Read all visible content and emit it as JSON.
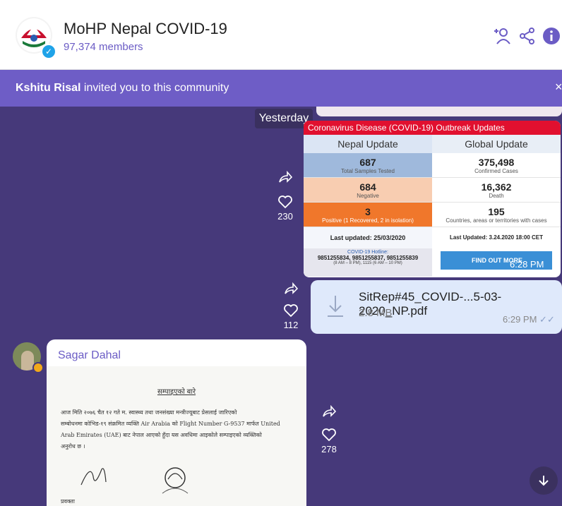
{
  "header": {
    "title": "MoHP Nepal COVID-19",
    "members": "97,374 members"
  },
  "banner": {
    "inviter": "Kshitu Risal",
    "text": " invited you to this community",
    "close": "×"
  },
  "chat": {
    "day_label": "Yesterday",
    "card": {
      "header": "Coronavirus Disease (COVID-19) Outbreak Updates",
      "nepal_title": "Nepal Update",
      "global_title": "Global Update",
      "nepal": [
        {
          "value": "687",
          "label": "Total Samples Tested"
        },
        {
          "value": "684",
          "label": "Negative"
        },
        {
          "value": "3",
          "label": "Positive (1 Recovered, 2 in isolation)"
        }
      ],
      "global": [
        {
          "value": "375,498",
          "label": "Confirmed Cases"
        },
        {
          "value": "16,362",
          "label": "Death"
        },
        {
          "value": "195",
          "label": "Countries, areas or territories with cases"
        }
      ],
      "nepal_updated": "Last updated: 25/03/2020",
      "global_updated": "Last Updated: 3.24.2020 18:00 CET",
      "hotline_title": "COVID-19 Hotline:",
      "hotline_numbers": "9851255834, 9851255837, 9851255839",
      "hotline_hours": "(8 AM – 8 PM), 1115 (6 AM – 10 PM)",
      "find_out_more": "FIND OUT MORE",
      "time": "6:28 PM",
      "likes": "230"
    },
    "pdf": {
      "filename": "SitRep#45_COVID-...5-03-2020_NP.pdf",
      "size": "2.8 MB",
      "time": "6:29 PM",
      "likes": "112"
    },
    "message": {
      "sender": "Sagar Dahal",
      "likes": "278",
      "doc_title": "सम्पाइएको बारे",
      "doc_line1": "आज मिति २०७६ चैत १२ गते म. स्वास्थ्य तथा जनसंख्या मन्त्रीज्यूबाट प्रेसलाई जारिएको",
      "doc_line2": "सम्बोधनमा कोभिड-१९ संक्रमित व्यक्ति Air Arabia को Flight Number G-9537 मार्फत United",
      "doc_line3": "Arab Emirates (UAE) बाट नेपाल आएको हुँदा यस अवधिमा आइकोले सम्पाइएको व्यक्तिको",
      "doc_line4": "अनुरोध छ ।",
      "doc_sign": "प्रवक्ता"
    }
  },
  "colors": {
    "accent": "#6b5cc5",
    "chat_bg": "#46397a",
    "banner": "#6e5dc6",
    "covid_red": "#e1102f"
  }
}
